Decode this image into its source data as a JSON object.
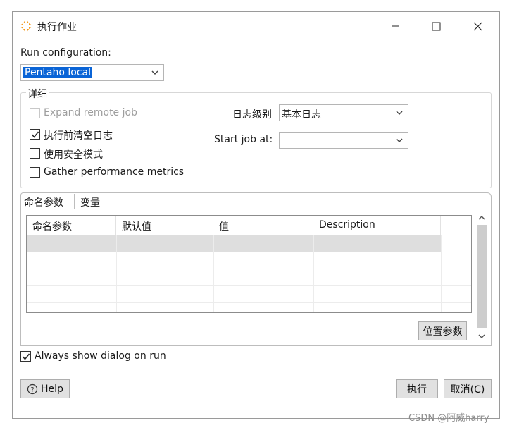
{
  "window": {
    "title": "执行作业",
    "icon": "pentaho-job-icon",
    "controls": {
      "minimize": "—",
      "maximize": "☐",
      "close": "✕"
    }
  },
  "run_config": {
    "label": "Run configuration:",
    "value": "Pentaho local"
  },
  "details": {
    "group_label": "详细",
    "options": [
      {
        "label": "Expand remote job",
        "checked": false,
        "enabled": false
      },
      {
        "label": "执行前清空日志",
        "checked": true,
        "enabled": true
      },
      {
        "label": "使用安全模式",
        "checked": false,
        "enabled": true
      },
      {
        "label": "Gather performance metrics",
        "checked": false,
        "enabled": true
      }
    ],
    "log_level_label": "日志级别",
    "log_level_value": "基本日志",
    "start_job_label": "Start job at:",
    "start_job_value": ""
  },
  "tabs": [
    {
      "label": "命名参数",
      "active": true
    },
    {
      "label": "变量",
      "active": false
    }
  ],
  "params_table": {
    "columns": [
      "命名参数",
      "默认值",
      "值",
      "Description"
    ],
    "rows": [
      [
        "",
        "",
        "",
        ""
      ],
      [
        "",
        "",
        "",
        ""
      ],
      [
        "",
        "",
        "",
        ""
      ],
      [
        "",
        "",
        "",
        ""
      ],
      [
        "",
        "",
        "",
        ""
      ]
    ]
  },
  "position_params_button": "位置参数",
  "always_show": {
    "label": "Always show dialog on run",
    "checked": true
  },
  "help_button": "Help",
  "execute_button": "执行",
  "cancel_button": "取消(C)",
  "watermark": "CSDN @阿威harry",
  "colors": {
    "selection": "#0a64d6",
    "accent_icon": "#f39a1e"
  }
}
